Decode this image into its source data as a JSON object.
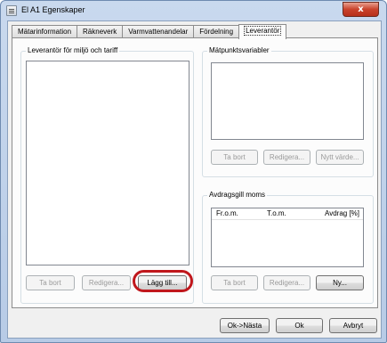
{
  "window": {
    "title": "El A1 Egenskaper",
    "close_glyph": "x"
  },
  "tabs": [
    {
      "label": "Mätarinformation",
      "active": false
    },
    {
      "label": "Räkneverk",
      "active": false
    },
    {
      "label": "Varmvattenandelar",
      "active": false
    },
    {
      "label": "Fördelning",
      "active": false
    },
    {
      "label": "Leverantör",
      "active": true
    }
  ],
  "supplier_group": {
    "label": "Leverantör för miljö och tariff",
    "buttons": {
      "remove": "Ta bort",
      "edit": "Redigera...",
      "add": "Lägg till..."
    }
  },
  "meter_point_group": {
    "label": "Mätpunktsvariabler",
    "buttons": {
      "remove": "Ta bort",
      "edit": "Redigera...",
      "new_value": "Nytt värde..."
    }
  },
  "vat_group": {
    "label": "Avdragsgill moms",
    "columns": [
      "Fr.o.m.",
      "T.o.m.",
      "Avdrag [%]"
    ],
    "buttons": {
      "remove": "Ta bort",
      "edit": "Redigera...",
      "new": "Ny..."
    }
  },
  "footer": {
    "ok_next": "Ok->Nästa",
    "ok": "Ok",
    "cancel": "Avbryt"
  },
  "colors": {
    "highlight_ring": "#c0171c",
    "close_button": "#c9432c"
  }
}
